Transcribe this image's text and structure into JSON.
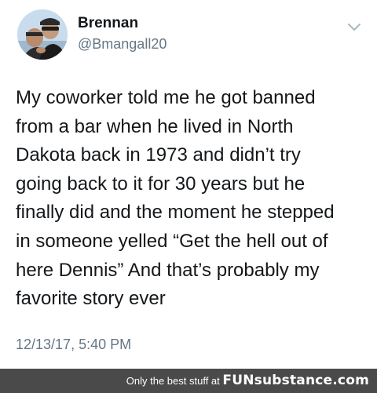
{
  "tweet": {
    "author_name": "Brennan",
    "author_handle": "@Bmangall20",
    "text": "My coworker told me he got banned\nfrom a bar when he lived in North\nDakota back in 1973 and didn’t try\ngoing back to it for 30 years but he\nfinally did and the moment he stepped\nin someone yelled “Get the hell out of\nhere Dennis” And that’s probably my\nfavorite story ever",
    "timestamp": "12/13/17, 5:40 PM",
    "menu_icon": "chevron-down-icon"
  },
  "footer": {
    "tagline": "Only the best stuff at",
    "brand": "FUNsubstance.com"
  },
  "colors": {
    "text": "#14171a",
    "secondary": "#657786",
    "footer_bg": "#4a4a4a"
  }
}
